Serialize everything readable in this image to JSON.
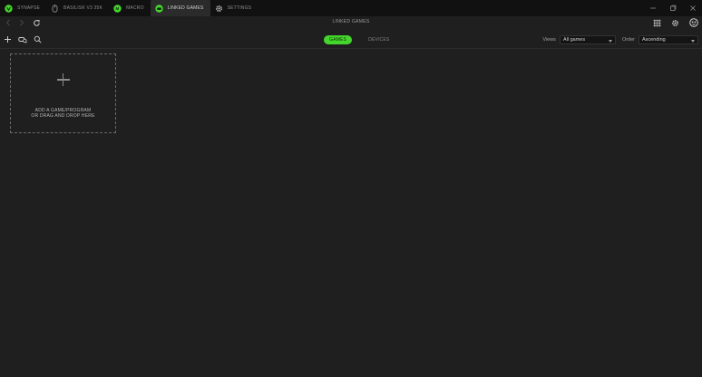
{
  "tabs": [
    {
      "label": "SYNAPSE",
      "icon": "razer-logo-icon",
      "active": false
    },
    {
      "label": "BASILISK V3 35K",
      "icon": "mouse-icon",
      "active": false
    },
    {
      "label": "MACRO",
      "icon": "macro-icon",
      "active": false
    },
    {
      "label": "LINKED GAMES",
      "icon": "gamepad-icon",
      "active": true
    },
    {
      "label": "SETTINGS",
      "icon": "gear-icon",
      "active": false
    }
  ],
  "window_controls": [
    "minimize-icon",
    "maximize-icon",
    "close-icon"
  ],
  "page": {
    "title": "LINKED GAMES"
  },
  "toolbar": {
    "segments": [
      {
        "label": "GAMES",
        "active": true
      },
      {
        "label": "DEVICES",
        "active": false
      }
    ],
    "views_label": "Views",
    "views_value": "All games",
    "order_label": "Order",
    "order_value": "Ascending"
  },
  "add_card": {
    "line1": "ADD A GAME/PROGRAM",
    "line2": "OR DRAG AND DROP HERE"
  },
  "colors": {
    "accent": "#44d62c",
    "background": "#1f1f1f",
    "titlebar": "#111111"
  }
}
